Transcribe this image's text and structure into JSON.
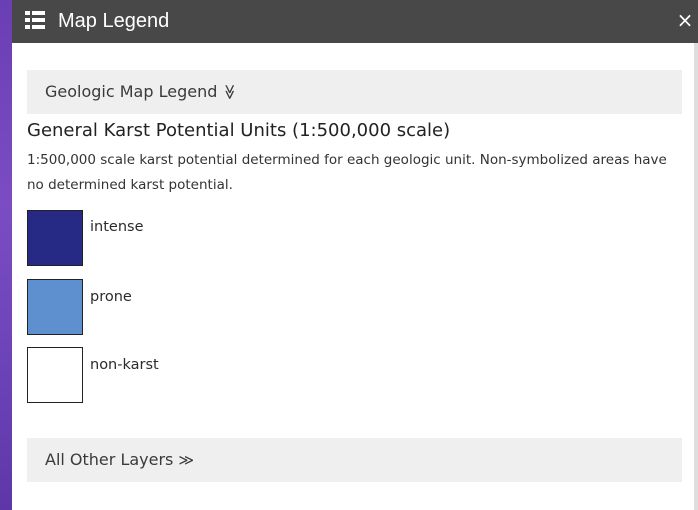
{
  "window": {
    "title": "Map Legend",
    "close_glyph": "×",
    "icon": "legend-list-icon"
  },
  "sections": {
    "geologic": {
      "label": "Geologic Map Legend",
      "chevron": "≫",
      "state": "expanded"
    },
    "other": {
      "label": "All Other Layers",
      "chevron": "≫",
      "state": "collapsed"
    }
  },
  "layer": {
    "title": "General Karst Potential Units (1:500,000 scale)",
    "description": "1:500,000 scale karst potential determined for each geologic unit. Non-symbolized areas have no determined karst potential.",
    "items": [
      {
        "label": "intense",
        "color": "#262a85"
      },
      {
        "label": "prone",
        "color": "#5e90cf"
      },
      {
        "label": "non-karst",
        "color": "#ffffff"
      }
    ]
  },
  "colors": {
    "header_bg": "#484848",
    "section_bg": "#efefef",
    "map_edge": "#6a3fb3"
  }
}
